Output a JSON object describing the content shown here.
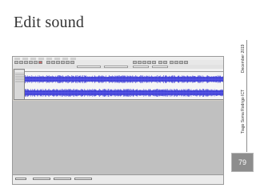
{
  "slide": {
    "title": "Edit sound",
    "side_author": "Tiago Soma Rodrigo ICT",
    "side_date": "December 2019",
    "page_number": "79"
  },
  "colors": {
    "waveform": "#3b3bd6",
    "waveform_center": "#6a6af0",
    "track_background": "#f5f5f5",
    "editor_background": "#c0c0c0",
    "page_badge": "#8d8d8d"
  },
  "editor": {
    "menu_count": 8,
    "toolbar_icons": [
      "selection-tool-icon",
      "envelope-tool-icon",
      "draw-tool-icon",
      "zoom-tool-icon",
      "timeshift-tool-icon",
      "multi-tool-icon",
      "record-meter-icon",
      "playback-meter-icon"
    ],
    "tracks": [
      {
        "channel": "left"
      },
      {
        "channel": "right"
      }
    ]
  }
}
